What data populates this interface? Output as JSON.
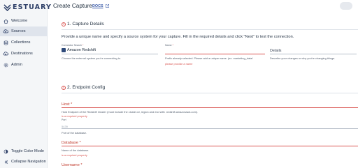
{
  "app": {
    "brand": "ESTUARY"
  },
  "sidebar": {
    "items": [
      {
        "label": "Welcome",
        "icon": "home-icon"
      },
      {
        "label": "Sources",
        "icon": "cloud-upload-icon",
        "active": true
      },
      {
        "label": "Collections",
        "icon": "database-icon"
      },
      {
        "label": "Destinations",
        "icon": "cloud-download-icon"
      },
      {
        "label": "Admin",
        "icon": "gear-icon"
      }
    ],
    "bottom": [
      {
        "label": "Toggle Color Mode",
        "icon": "color-mode-icon"
      },
      {
        "label": "Collapse Navigation",
        "icon": "collapse-icon"
      }
    ]
  },
  "header": {
    "title": "Create Capture",
    "docs_label": "DOCS"
  },
  "capture_details": {
    "title": "1. Capture Details",
    "intro": "Provide a unique name and specify a source system for your capture. Fill in the required details and click \"Next\" to test the connection.",
    "connector": {
      "label": "Connector Search",
      "value": "Amazon Redshift",
      "helper": "Choose the external system you're connecting to."
    },
    "name": {
      "label": "Name",
      "helper": "Prefix already selected. Please add a unique name. (ex. marketing_data/",
      "error": "please provide a name"
    },
    "details": {
      "label": "Details",
      "helper": "Describe your changes or why you're changing things."
    }
  },
  "endpoint_config": {
    "title": "2. Endpoint Config",
    "host": {
      "label": "Host",
      "helper": "Host Endpoint of the Redshift Cluster (must include the cluster-id, region and end with .redshift.amazonaws.com).",
      "error": "is a required property"
    },
    "port": {
      "label": "Port",
      "value": "5439",
      "helper": "Port of the database."
    },
    "database": {
      "label": "Database",
      "helper": "Name of the database.",
      "error": "is a required property"
    },
    "username": {
      "label": "Username"
    }
  },
  "colors": {
    "accent": "#2c3e66",
    "error": "#d9534f",
    "active_bg": "#dfe4ec"
  }
}
